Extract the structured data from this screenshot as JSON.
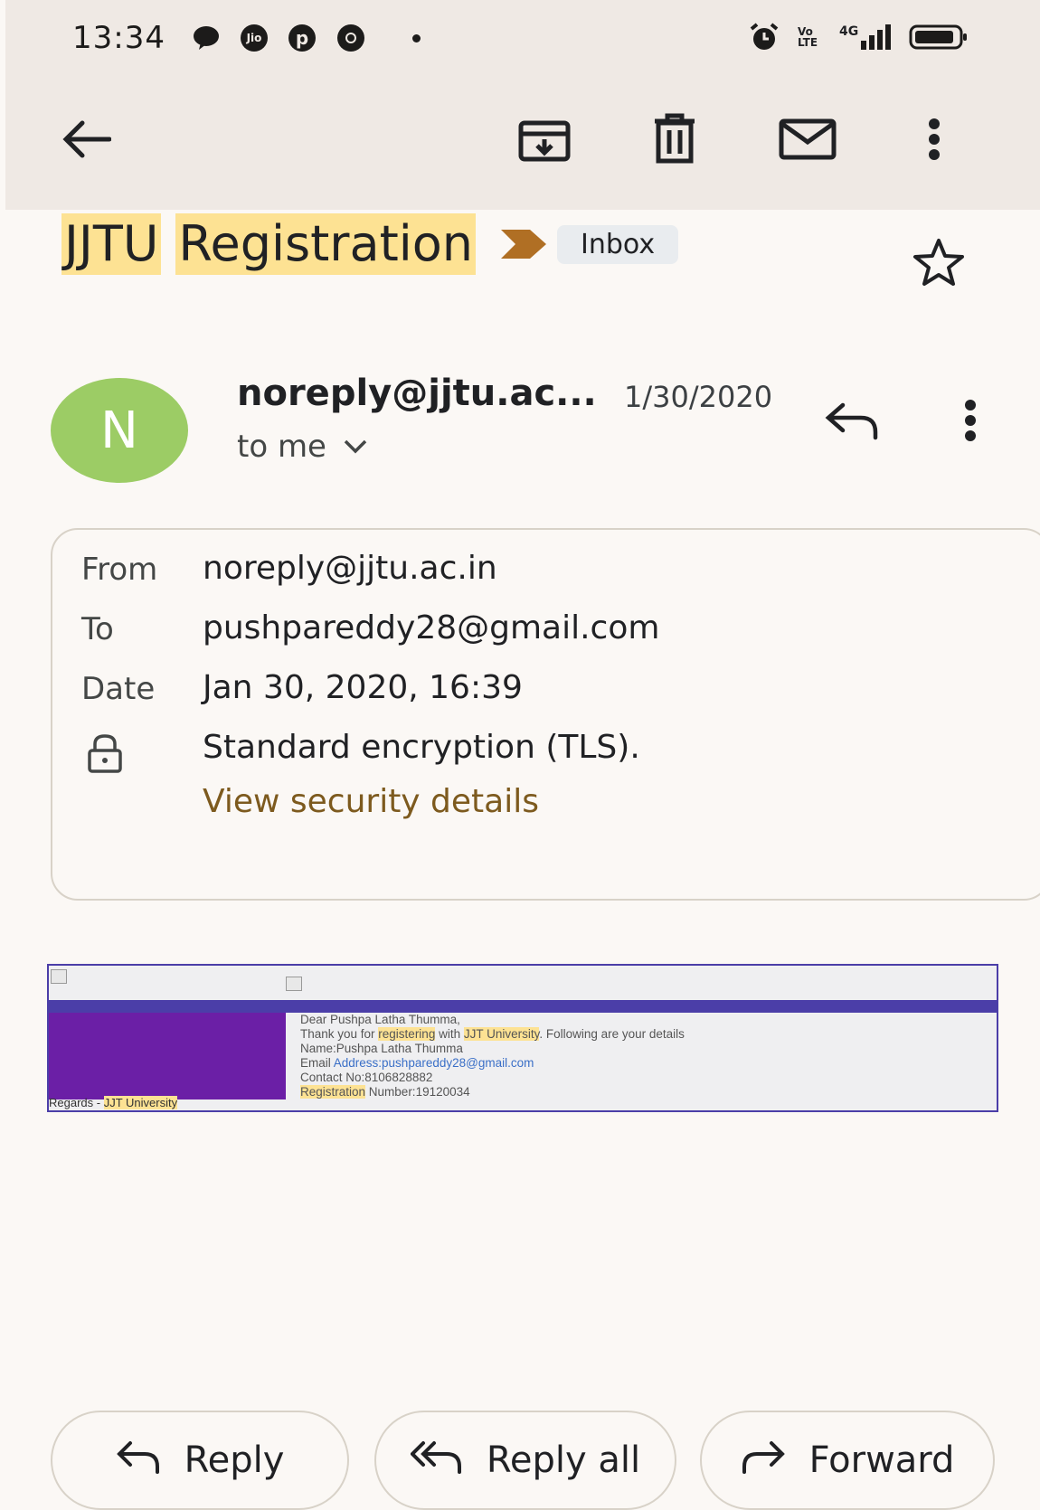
{
  "status_bar": {
    "time": "13:34",
    "left_icons": [
      "chat-icon",
      "jio-icon",
      "pinterest-icon",
      "chrome-icon",
      "dot-icon"
    ],
    "right_icons": [
      "alarm-icon",
      "volte-icon",
      "signal-4g-icon",
      "battery-icon"
    ],
    "jio_text": "Jio",
    "volte_text": "Vo LTE",
    "network_text": "4G"
  },
  "toolbar": {
    "back_icon": "arrow-left-icon",
    "actions": [
      "archive-icon",
      "delete-icon",
      "mark-unread-icon",
      "more-vert-icon"
    ]
  },
  "subject": {
    "word1": "JJTU",
    "word2": "Registration",
    "label": "Inbox"
  },
  "sender": {
    "avatar_letter": "N",
    "name": "noreply@jjtu.ac...",
    "date": "1/30/2020",
    "to": "to me"
  },
  "details": {
    "from_label": "From",
    "from_value": "noreply@jjtu.ac.in",
    "to_label": "To",
    "to_value": "pushpareddy28@gmail.com",
    "date_label": "Date",
    "date_value": "Jan 30, 2020, 16:39",
    "encryption": "Standard encryption (TLS).",
    "security_link": "View security details"
  },
  "message": {
    "line1": "Dear Pushpa Latha Thumma,",
    "line2_a": "Thank you for ",
    "line2_b": "registering",
    "line2_c": " with ",
    "line2_d": "JJT University",
    "line2_e": ". Following are your details",
    "line3": "Name:Pushpa Latha Thumma",
    "line4_a": "Email ",
    "line4_b": "Address:pushpareddy28@gmail.com",
    "line5": "Contact No:8106828882",
    "line6_a": "Registration",
    "line6_b": " Number:19120034",
    "regards_a": "Regards - ",
    "regards_b": "JJT University"
  },
  "actions": {
    "reply": "Reply",
    "reply_all": "Reply all",
    "forward": "Forward"
  },
  "colors": {
    "toolbar_bg": "#efe9e4",
    "page_bg": "#fbf8f5",
    "highlight": "#fde293",
    "avatar": "#9ccc65",
    "label_arrow": "#b06f24",
    "link": "#7d5a1e",
    "mail_band": "#4b3ea8",
    "mail_side": "#6b1fa6"
  }
}
